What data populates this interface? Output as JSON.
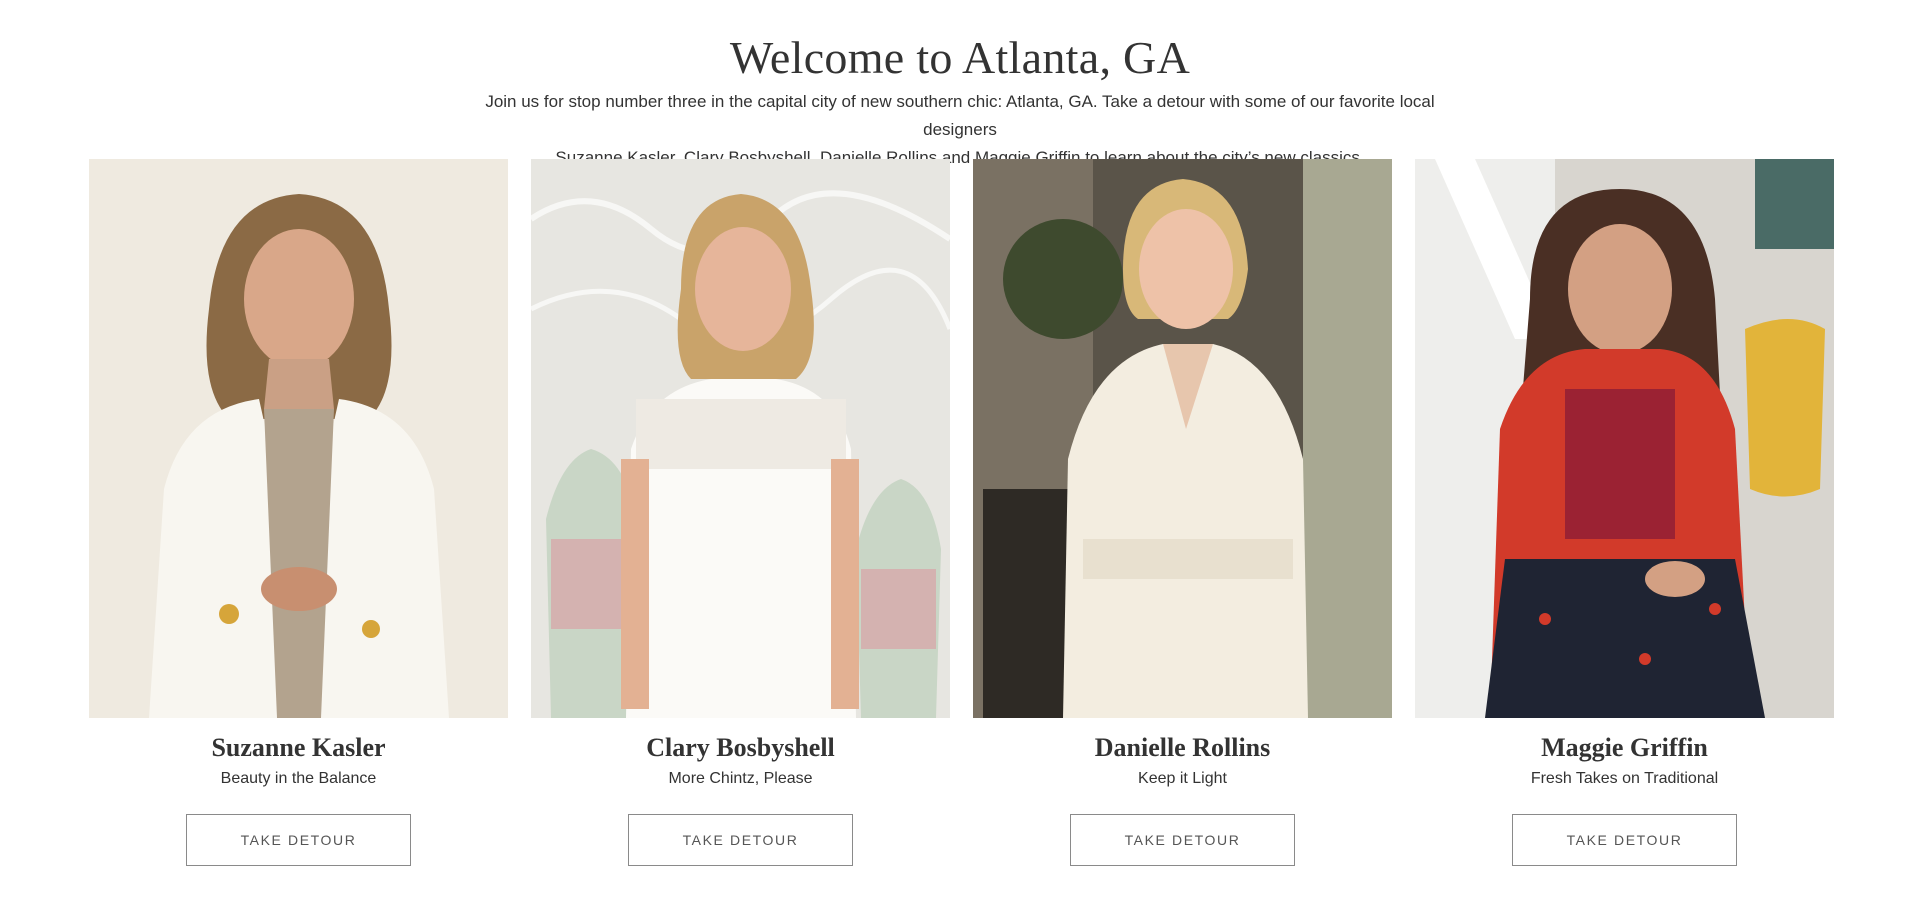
{
  "header": {
    "title": "Welcome to Atlanta, GA",
    "intro_line1": "Join us for stop number three in the capital city of new southern chic: Atlanta, GA. Take a detour with some of our favorite local designers",
    "intro_line2": "Suzanne Kasler, Clary Bosbyshell, Danielle Rollins and Maggie Griffin to learn about the city’s new classics."
  },
  "designers": [
    {
      "name": "Suzanne Kasler",
      "tagline": "Beauty in the Balance",
      "button": "TAKE DETOUR"
    },
    {
      "name": "Clary Bosbyshell",
      "tagline": "More Chintz, Please",
      "button": "TAKE DETOUR"
    },
    {
      "name": "Danielle Rollins",
      "tagline": "Keep it Light",
      "button": "TAKE DETOUR"
    },
    {
      "name": "Maggie Griffin",
      "tagline": "Fresh Takes on Traditional",
      "button": "TAKE DETOUR"
    }
  ],
  "colors": {
    "text": "#333333",
    "button_border": "#8a8a8a",
    "button_text": "#555555"
  }
}
